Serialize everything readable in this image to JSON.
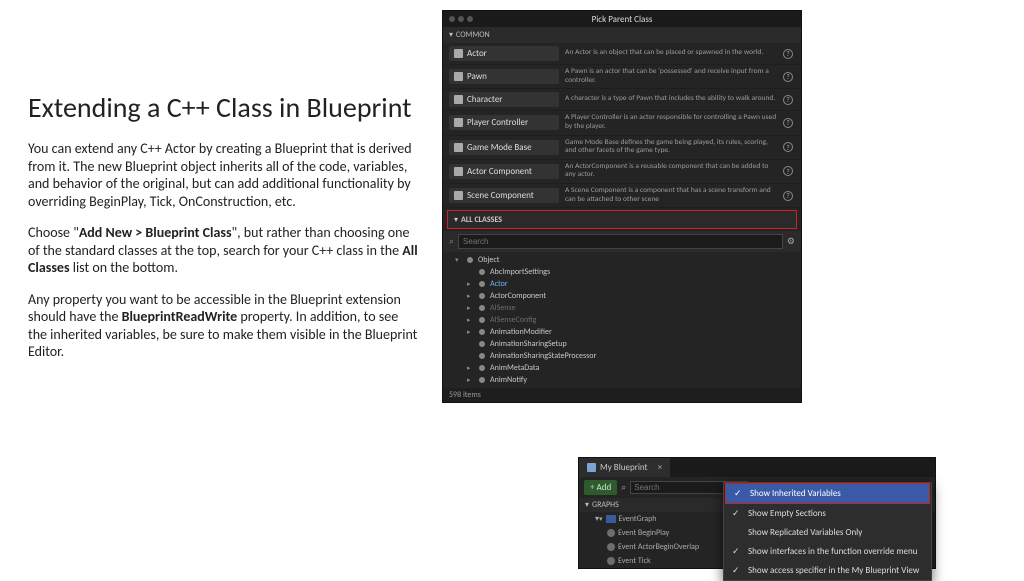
{
  "heading": "Extending a C++ Class in Blueprint",
  "p1": "You can extend any C++ Actor by creating a Blueprint that is derived from it. The new Blueprint object inherits all of the code, variables, and behavior of the original, but can add additional functionality by overriding BeginPlay, Tick, OnConstruction, etc.",
  "p2a": "Choose \"",
  "p2b": "Add New > Blueprint Class",
  "p2c": "\", but rather than choosing one of the standard classes at the top, search for your C++ class in the ",
  "p2d": "All Classes",
  "p2e": " list on the bottom.",
  "p3a": "Any property you want to be accessible in the Blueprint extension should have the ",
  "p3b": "BlueprintReadWrite",
  "p3c": " property. In addition, to see the inherited variables, be sure to make them visible in the Blueprint Editor.",
  "pick": {
    "title": "Pick Parent Class",
    "common": "COMMON",
    "classes": [
      {
        "name": "Actor",
        "desc": "An Actor is an object that can be placed or spawned in the world."
      },
      {
        "name": "Pawn",
        "desc": "A Pawn is an actor that can be 'possessed' and receive input from a controller."
      },
      {
        "name": "Character",
        "desc": "A character is a type of Pawn that includes the ability to walk around."
      },
      {
        "name": "Player Controller",
        "desc": "A Player Controller is an actor responsible for controlling a Pawn used by the player."
      },
      {
        "name": "Game Mode Base",
        "desc": "Game Mode Base defines the game being played, its rules, scoring, and other facets of the game type."
      },
      {
        "name": "Actor Component",
        "desc": "An ActorComponent is a reusable component that can be added to any actor."
      },
      {
        "name": "Scene Component",
        "desc": "A Scene Component is a component that has a scene transform and can be attached to other scene"
      }
    ],
    "allclasses": "ALL CLASSES",
    "search": "Search",
    "tree": [
      {
        "label": "Object",
        "ind": 0,
        "exp": true
      },
      {
        "label": "AbcImportSettings",
        "ind": 1
      },
      {
        "label": "Actor",
        "ind": 1,
        "blue": true,
        "ex": true
      },
      {
        "label": "ActorComponent",
        "ind": 1,
        "ex": true
      },
      {
        "label": "AISense",
        "ind": 1,
        "muted": true,
        "ex": true
      },
      {
        "label": "AISenseConfig",
        "ind": 1,
        "muted": true,
        "ex": true
      },
      {
        "label": "AnimationModifier",
        "ind": 1,
        "ex": true
      },
      {
        "label": "AnimationSharingSetup",
        "ind": 1
      },
      {
        "label": "AnimationSharingStateProcessor",
        "ind": 1
      },
      {
        "label": "AnimMetaData",
        "ind": 1,
        "ex": true
      },
      {
        "label": "AnimNotify",
        "ind": 1,
        "ex": true
      }
    ],
    "footer": "598 items"
  },
  "bp": {
    "tab": "My Blueprint",
    "add": "Add",
    "search": "Search",
    "graphs": "GRAPHS",
    "eventgraph": "EventGraph",
    "events": [
      "Event BeginPlay",
      "Event ActorBeginOverlap",
      "Event Tick"
    ]
  },
  "ctx": {
    "items": [
      {
        "label": "Show Inherited Variables",
        "checked": true,
        "hi": true
      },
      {
        "label": "Show Empty Sections",
        "checked": true
      },
      {
        "label": "Show Replicated Variables Only"
      },
      {
        "label": "Show interfaces in the function override menu",
        "checked": true
      },
      {
        "label": "Show access specifier in the My Blueprint View",
        "checked": true
      }
    ]
  }
}
